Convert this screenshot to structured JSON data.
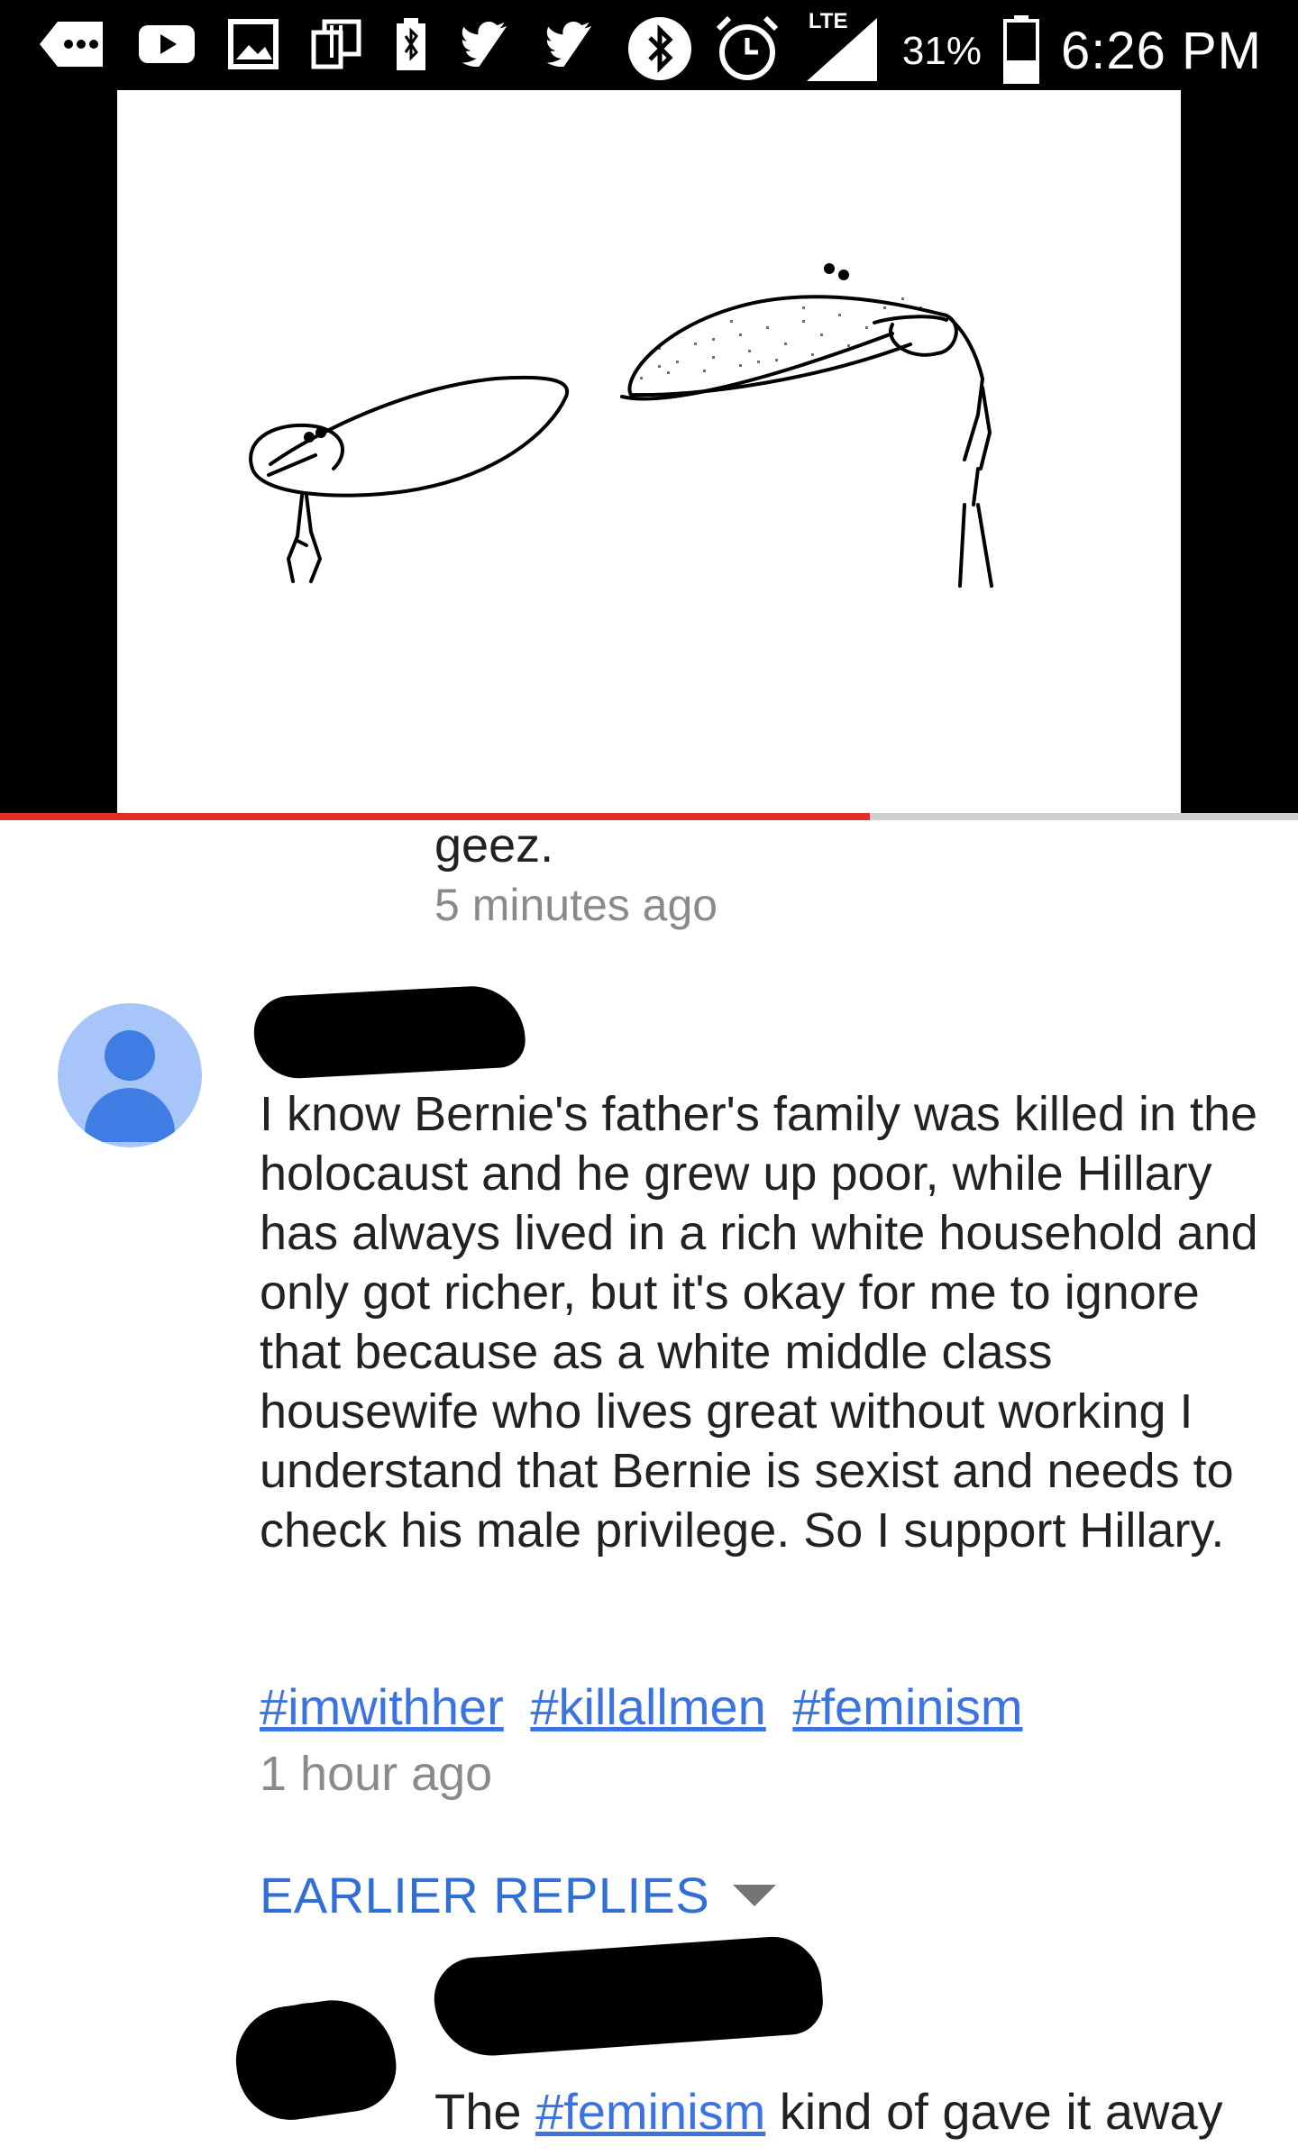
{
  "status_bar": {
    "time": "6:26 PM",
    "battery_percent": "31%",
    "network": "LTE",
    "icons": [
      "more-icon",
      "youtube-icon",
      "image-icon",
      "copy-icon",
      "battery-charging-icon",
      "twitter-icon",
      "twitter-icon",
      "bluetooth-icon",
      "alarm-icon",
      "signal-icon",
      "battery-icon"
    ]
  },
  "video": {
    "progress": 0.67
  },
  "previous_reply": {
    "text": "geez.",
    "timestamp": "5 minutes ago"
  },
  "comment": {
    "author": "",
    "text": "I know Bernie's father's family was killed in the holocaust and he grew up poor, while Hillary has always lived in a rich white household and only got richer, but it's okay for me to ignore that because as a white middle class housewife who lives great without working I understand that Bernie is sexist and needs to check his male privilege. So I support Hillary.",
    "hashtags": [
      "#imwithher",
      "#killallmen",
      "#feminism"
    ],
    "timestamp": "1 hour ago"
  },
  "earlier_replies_label": "EARLIER REPLIES",
  "reply": {
    "text_before": "The ",
    "hashtag": "#feminism",
    "text_after": " kind of gave it away"
  },
  "colors": {
    "link": "#3b73e0",
    "progress": "#e52d27",
    "avatar_bg": "#a7c5f9",
    "avatar_fg": "#3f7ce4"
  }
}
